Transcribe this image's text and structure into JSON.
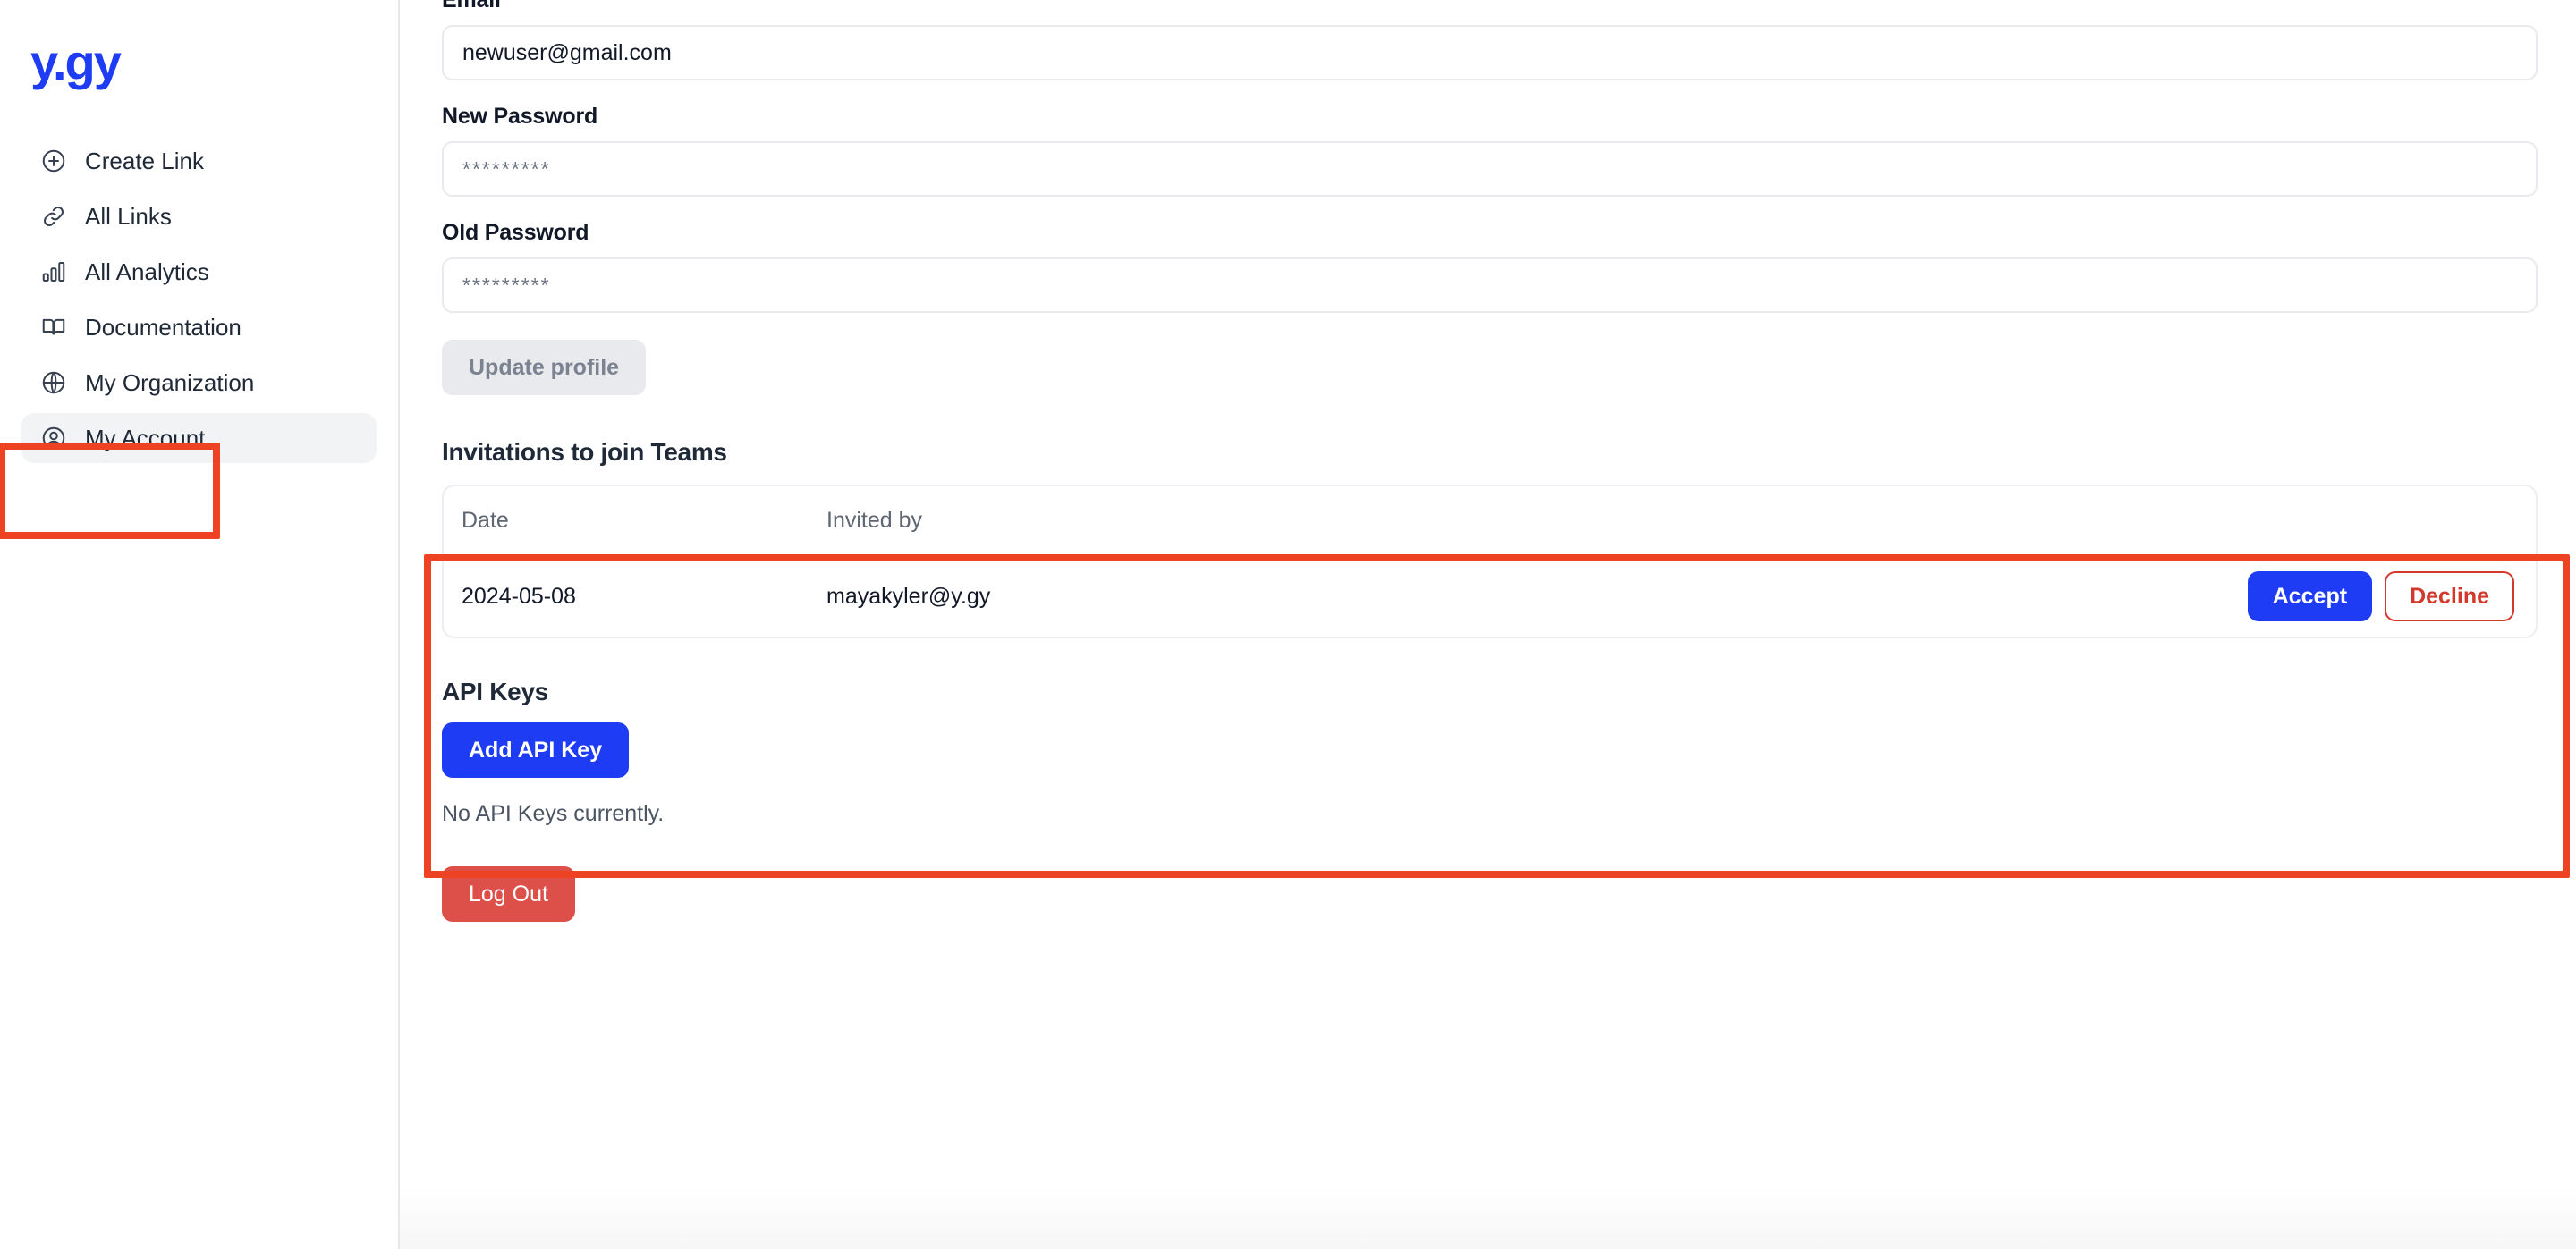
{
  "brand": {
    "logo_text": "y.gy",
    "accent_blue": "#1f3cf5",
    "annotation_red": "#ee4323"
  },
  "sidebar": {
    "items": [
      {
        "label": "Create Link",
        "icon": "plus-circle-icon",
        "active": false
      },
      {
        "label": "All Links",
        "icon": "link-icon",
        "active": false
      },
      {
        "label": "All Analytics",
        "icon": "bar-chart-icon",
        "active": false
      },
      {
        "label": "Documentation",
        "icon": "book-icon",
        "active": false
      },
      {
        "label": "My Organization",
        "icon": "globe-icon",
        "active": false
      },
      {
        "label": "My Account",
        "icon": "user-circle-icon",
        "active": true
      }
    ]
  },
  "profile_form": {
    "email_label": "Email",
    "email_value": "newuser@gmail.com",
    "new_password_label": "New Password",
    "new_password_placeholder": "*********",
    "old_password_label": "Old Password",
    "old_password_placeholder": "*********",
    "update_button_label": "Update profile",
    "update_button_disabled": true
  },
  "invitations": {
    "title": "Invitations to join Teams",
    "columns": [
      "Date",
      "Invited by"
    ],
    "rows": [
      {
        "date": "2024-05-08",
        "invited_by": "mayakyler@y.gy",
        "accept_label": "Accept",
        "decline_label": "Decline"
      }
    ]
  },
  "api_keys": {
    "title": "API Keys",
    "add_button_label": "Add API Key",
    "empty_text": "No API Keys currently."
  },
  "account_actions": {
    "logout_label": "Log Out"
  }
}
